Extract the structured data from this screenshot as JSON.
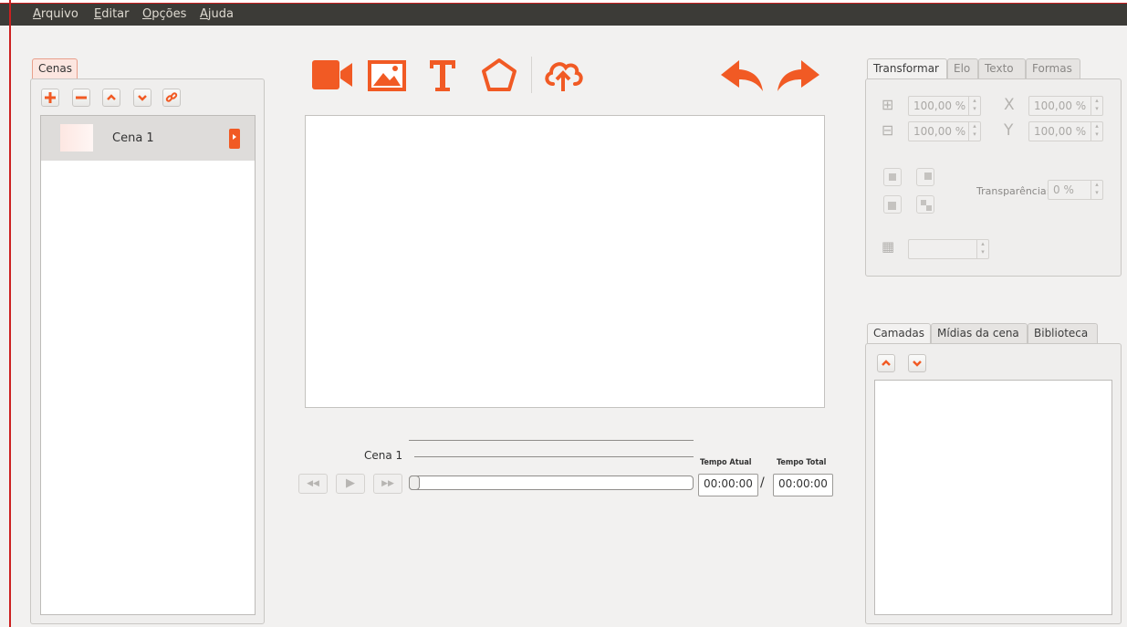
{
  "menubar": {
    "items": [
      {
        "key": "A",
        "rest": "rquivo"
      },
      {
        "key": "E",
        "rest": "ditar"
      },
      {
        "key": "O",
        "rest": "pções"
      },
      {
        "key": "A",
        "rest": "juda"
      }
    ]
  },
  "scenes_panel": {
    "tab_label": "Cenas",
    "buttons": [
      "add-icon",
      "remove-icon",
      "move-up-icon",
      "move-down-icon",
      "link-icon"
    ],
    "scenes": [
      {
        "name": "Cena 1"
      }
    ]
  },
  "toolbar": {
    "tools": [
      "video-icon",
      "image-icon",
      "text-icon",
      "shape-icon",
      "upload-icon"
    ],
    "undo_icon": "undo-icon",
    "redo_icon": "redo-icon",
    "accent_color": "#f15a24"
  },
  "player": {
    "scene_label": "Cena 1",
    "buttons": [
      "rewind-icon",
      "play-icon",
      "fast-forward-icon"
    ],
    "current_time_label": "Tempo Atual",
    "total_time_label": "Tempo Total",
    "current_time": "00:00:00",
    "separator": "/",
    "total_time": "00:00:00"
  },
  "properties_panel": {
    "tabs": [
      "Transformar",
      "Elo",
      "Texto",
      "Formas"
    ],
    "width_scale": "100,00 %",
    "height_scale": "100,00 %",
    "x_scale": "100,00 %",
    "y_scale": "100,00 %",
    "transparency_label": "Transparência:",
    "transparency_value": "0 %"
  },
  "layers_panel": {
    "tabs": [
      "Camadas",
      "Mídias da cena",
      "Biblioteca"
    ]
  }
}
